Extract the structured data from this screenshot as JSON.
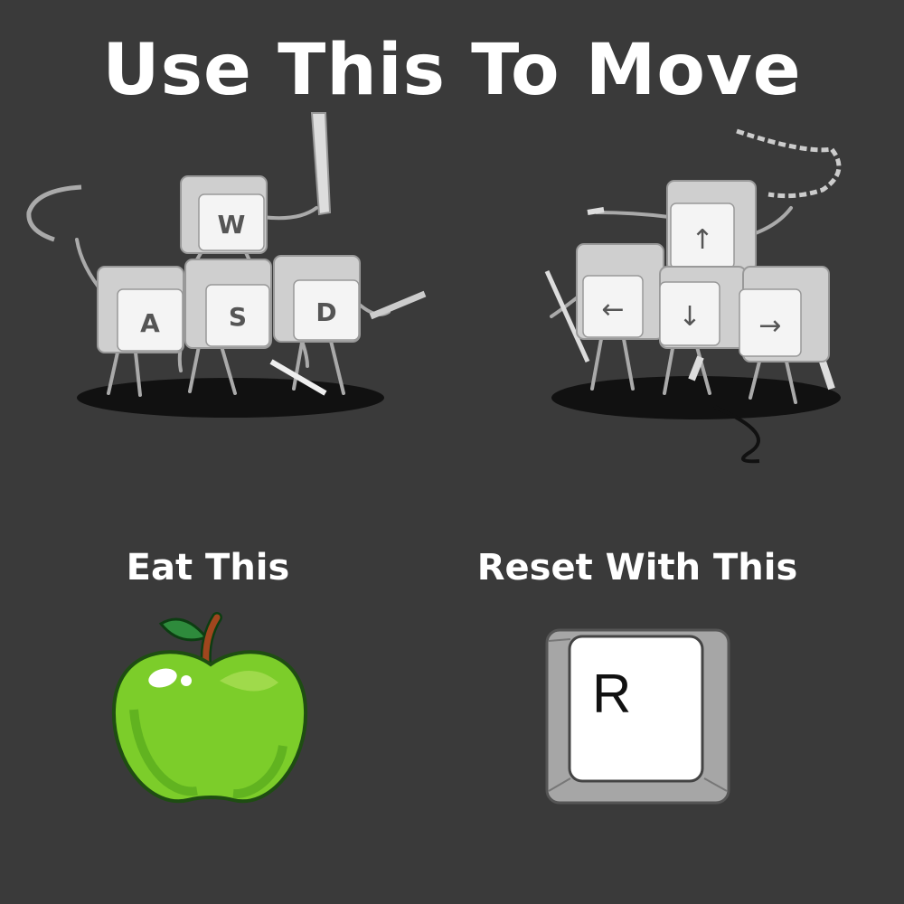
{
  "title": "Use This To Move",
  "wasd_keys": {
    "w": "W",
    "a": "A",
    "s": "S",
    "d": "D"
  },
  "arrow_keys": {
    "up": "↑",
    "left": "←",
    "down": "↓",
    "right": "→"
  },
  "eat_label": "Eat This",
  "reset_label": "Reset With This",
  "reset_key": "R",
  "colors": {
    "background": "#3a3a3a",
    "key_face": "#eeeeee",
    "apple_green": "#7ccd2a",
    "apple_stem": "#a0461e",
    "leaf": "#2e8b3c"
  },
  "icons": [
    "wasd-keys-illustration",
    "arrow-keys-illustration",
    "apple-icon",
    "r-key-icon"
  ]
}
